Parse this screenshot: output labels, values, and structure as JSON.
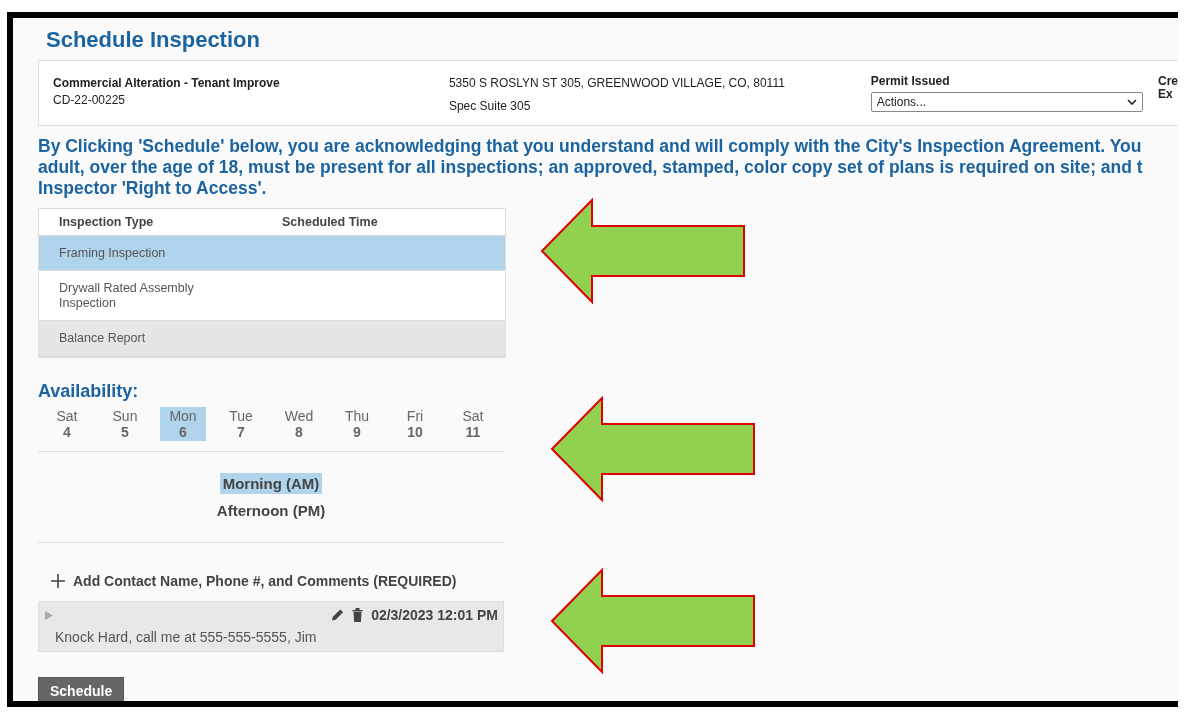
{
  "page_title": "Schedule Inspection",
  "permit": {
    "type": "Commercial Alteration - Tenant Improve",
    "number": "CD-22-00225",
    "address": "5350 S ROSLYN ST 305, GREENWOOD VILLAGE, CO, 80111",
    "unit": "Spec Suite 305",
    "status": "Permit Issued",
    "actions_select": "Actions...",
    "column_4_lines": [
      "Cre",
      "Ex"
    ]
  },
  "agreement_lines": [
    "By Clicking 'Schedule' below, you are acknowledging that you understand and will comply with the City's Inspection Agreement. You",
    "adult, over the age of 18, must be present for all inspections; an approved, stamped, color copy set of plans is required on site; and t",
    "Inspector 'Right to Access'."
  ],
  "table": {
    "columns": [
      "Inspection Type",
      "Scheduled Time"
    ],
    "rows": [
      {
        "type": "Framing Inspection",
        "selected": true,
        "shaded": false
      },
      {
        "type": "Drywall Rated Assembly Inspection",
        "selected": false,
        "shaded": false
      },
      {
        "type": "Balance Report",
        "selected": false,
        "shaded": true
      }
    ]
  },
  "availability": {
    "heading": "Availability:",
    "days": [
      {
        "weekday": "Sat",
        "date": "4",
        "selected": false
      },
      {
        "weekday": "Sun",
        "date": "5",
        "selected": false
      },
      {
        "weekday": "Mon",
        "date": "6",
        "selected": true
      },
      {
        "weekday": "Tue",
        "date": "7",
        "selected": false
      },
      {
        "weekday": "Wed",
        "date": "8",
        "selected": false
      },
      {
        "weekday": "Thu",
        "date": "9",
        "selected": false
      },
      {
        "weekday": "Fri",
        "date": "10",
        "selected": false
      },
      {
        "weekday": "Sat",
        "date": "11",
        "selected": false
      }
    ],
    "times": [
      {
        "label": "Morning (AM)",
        "selected": true
      },
      {
        "label": "Afternoon (PM)",
        "selected": false
      }
    ]
  },
  "add_contact": "Add Contact Name, Phone #, and Comments (REQUIRED)",
  "comment": {
    "timestamp": "02/3/2023 12:01 PM",
    "text": "Knock Hard, call me at 555-555-5555, Jim"
  },
  "schedule_button": "Schedule",
  "callouts": [
    {
      "kind": "arrow",
      "color": "#92d050"
    },
    {
      "kind": "arrow",
      "color": "#92d050"
    },
    {
      "kind": "arrow",
      "color": "#92d050"
    }
  ]
}
